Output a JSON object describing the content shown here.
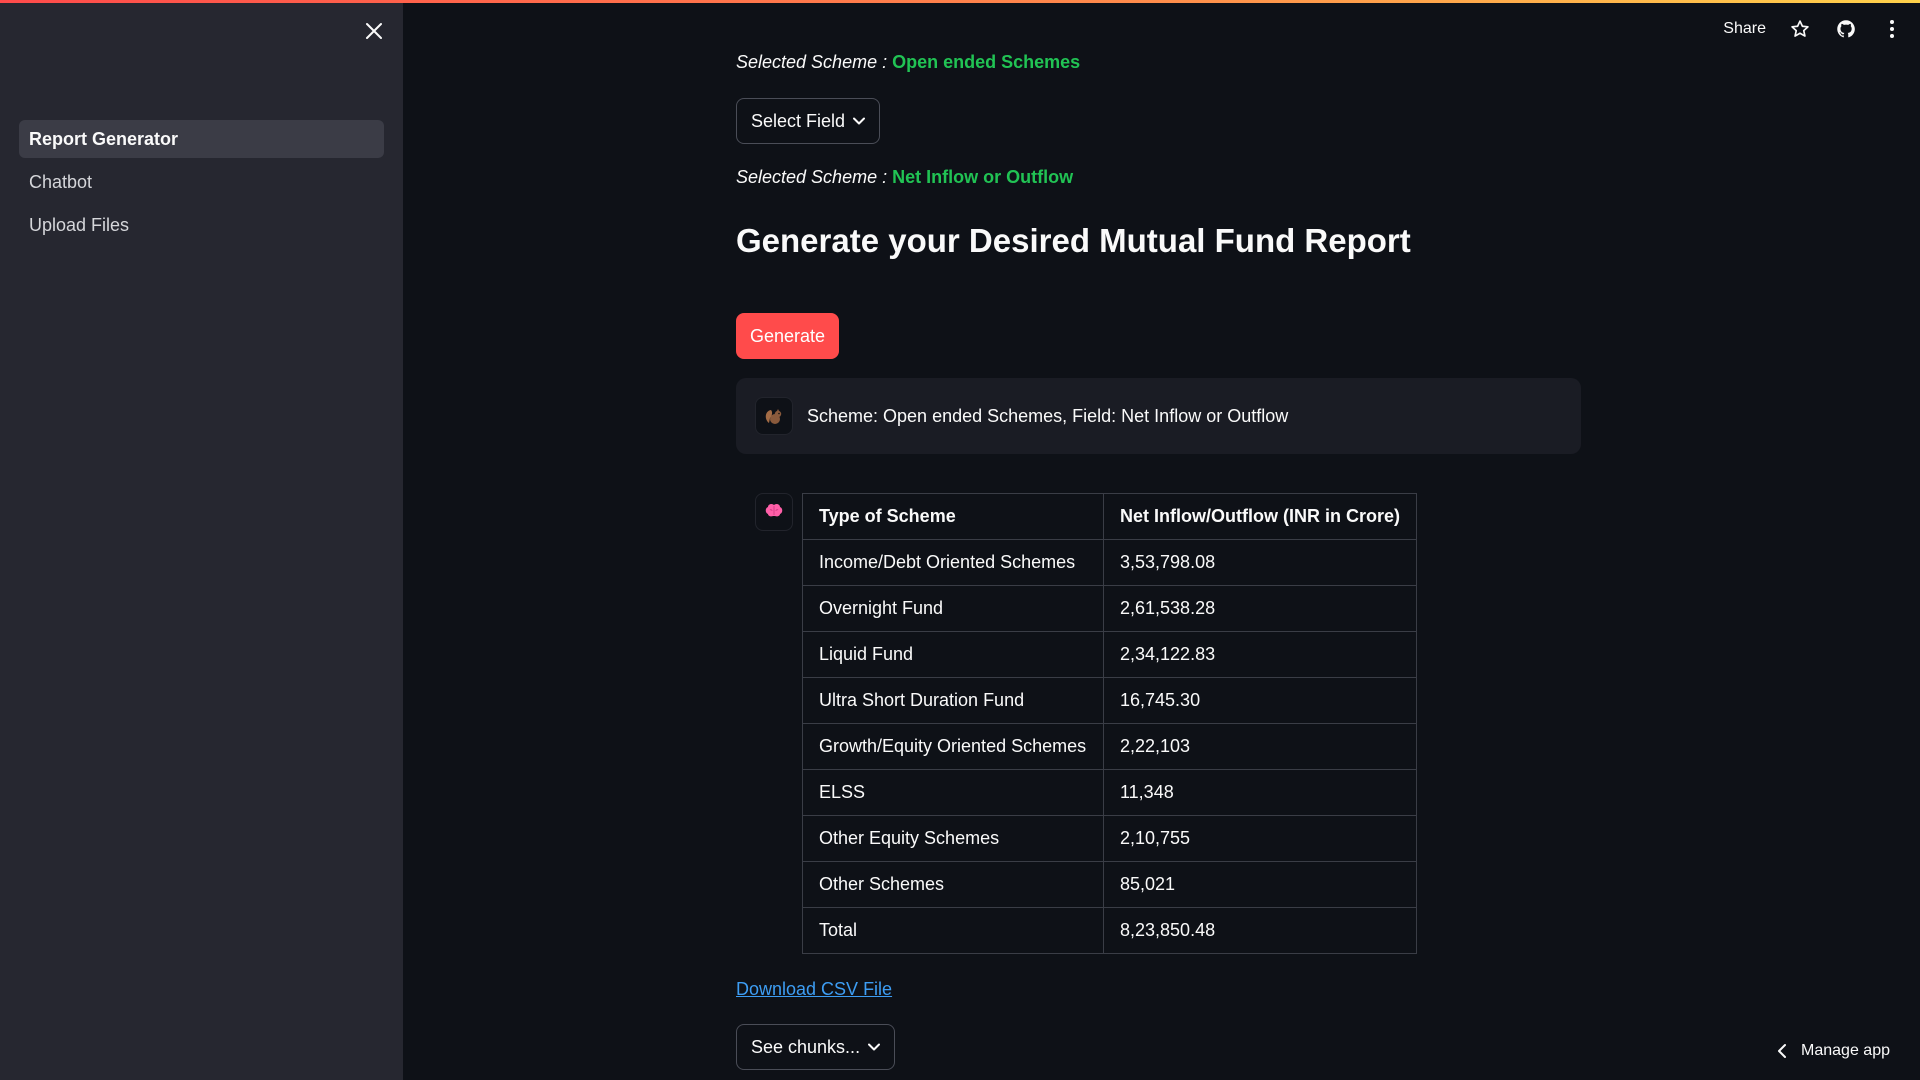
{
  "header": {
    "share_label": "Share",
    "icons": [
      "star-icon",
      "github-icon",
      "more-vertical-icon"
    ]
  },
  "sidebar": {
    "items": [
      {
        "label": "Report Generator",
        "active": true
      },
      {
        "label": "Chatbot",
        "active": false
      },
      {
        "label": "Upload Files",
        "active": false
      }
    ]
  },
  "main": {
    "scheme_line_1": {
      "prefix": "Selected Scheme : ",
      "value": "Open ended Schemes"
    },
    "select_field_label": "Select Field",
    "scheme_line_2": {
      "prefix": "Selected Scheme : ",
      "value": "Net Inflow or Outflow"
    },
    "title": "Generate your Desired Mutual Fund Report",
    "generate_label": "Generate",
    "user_message": "Scheme: Open ended Schemes, Field: Net Inflow or Outflow",
    "table": {
      "headers": [
        "Type of Scheme",
        "Net Inflow/Outflow (INR in Crore)"
      ],
      "rows": [
        [
          "Income/Debt Oriented Schemes",
          "3,53,798.08"
        ],
        [
          "Overnight Fund",
          "2,61,538.28"
        ],
        [
          "Liquid Fund",
          "2,34,122.83"
        ],
        [
          "Ultra Short Duration Fund",
          "16,745.30"
        ],
        [
          "Growth/Equity Oriented Schemes",
          "2,22,103"
        ],
        [
          "ELSS",
          "11,348"
        ],
        [
          "Other Equity Schemes",
          "2,10,755"
        ],
        [
          "Other Schemes",
          "85,021"
        ],
        [
          "Total",
          "8,23,850.48"
        ]
      ]
    },
    "download_label": "Download CSV File",
    "see_chunks_label": "See chunks..."
  },
  "footer": {
    "manage_app_label": "Manage app"
  },
  "colors": {
    "accent_green": "#21c354",
    "primary_red": "#ff4b4b",
    "link_blue": "#3d9df3",
    "sidebar_bg": "#262730",
    "main_bg": "#0e1117"
  }
}
